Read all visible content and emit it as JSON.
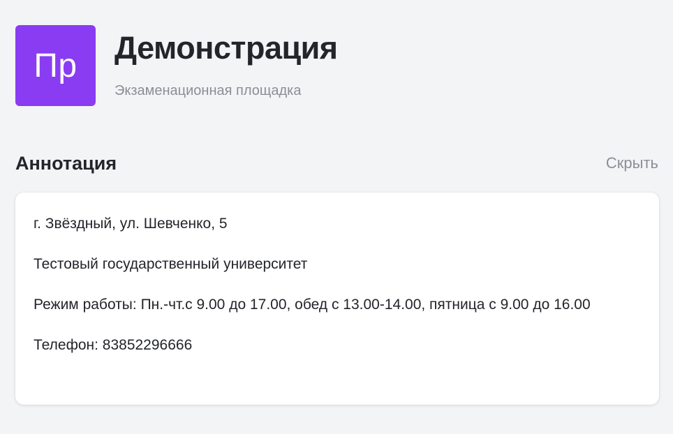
{
  "header": {
    "avatar_initials": "Пр",
    "avatar_color": "#8a3cf2",
    "title": "Демонстрация",
    "subtitle": "Экзаменационная площадка"
  },
  "annotation": {
    "title": "Аннотация",
    "hide_label": "Скрыть",
    "address": "г. Звёздный, ул. Шевченко, 5",
    "organization": "Тестовый государственный университет",
    "hours": "Режим работы: Пн.-чт.с 9.00 до 17.00, обед с 13.00-14.00, пятница с 9.00 до 16.00",
    "phone": "Телефон: 83852296666"
  }
}
